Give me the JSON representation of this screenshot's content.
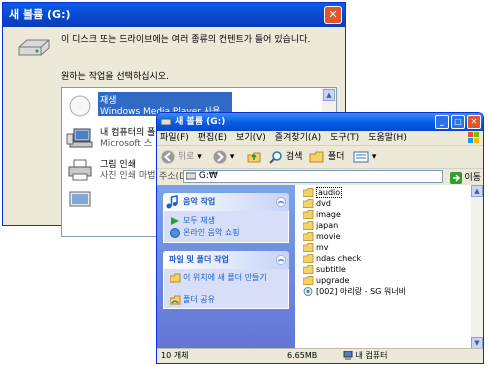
{
  "dialog": {
    "title": "새 볼륨 (G:)",
    "close_symbol": "✕",
    "message": "이 디스크 또는 드라이브에는 여러 종류의 컨텐트가 들어 있습니다.",
    "prompt": "원하는 작업을 선택하십시오.",
    "actions": [
      {
        "title": "재생",
        "subtitle": "Windows Media Player 사용",
        "icon": "media-player-icon"
      },
      {
        "title": "내 컴퓨터의 폴",
        "subtitle": "Microsoft 스",
        "icon": "copy-to-pc-icon"
      },
      {
        "title": "그림 인쇄",
        "subtitle": "사진 인쇄 마법",
        "icon": "printer-icon"
      },
      {
        "title": "",
        "subtitle": "",
        "icon": "slideshow-icon"
      }
    ]
  },
  "explorer": {
    "title": "새 볼륨 (G:)",
    "menu": [
      "파일(F)",
      "편집(E)",
      "보기(V)",
      "즐겨찾기(A)",
      "도구(T)",
      "도움말(H)"
    ],
    "toolbar": {
      "back": "뒤로",
      "search": "검색",
      "folders": "폴더"
    },
    "address": {
      "label": "주소(D)",
      "value": "G:₩",
      "go": "이동"
    },
    "music_tasks": {
      "header": "음악 작업",
      "items": [
        "모두 재생",
        "온라인 음악 쇼핑"
      ]
    },
    "file_tasks": {
      "header": "파일 및 폴더 작업",
      "items": [
        "이 위치에 새 폴더 만들기",
        "폴더 공유"
      ]
    },
    "files": [
      {
        "name": "audio",
        "type": "folder"
      },
      {
        "name": "dvd",
        "type": "folder"
      },
      {
        "name": "image",
        "type": "folder"
      },
      {
        "name": "japan",
        "type": "folder"
      },
      {
        "name": "movie",
        "type": "folder"
      },
      {
        "name": "mv",
        "type": "folder"
      },
      {
        "name": "ndas check",
        "type": "folder"
      },
      {
        "name": "subtitle",
        "type": "folder"
      },
      {
        "name": "upgrade",
        "type": "folder"
      },
      {
        "name": "[002] 아리랑 - SG 워너비",
        "type": "audio"
      }
    ],
    "status": {
      "count": "10 개체",
      "size": "6.65MB",
      "location": "내 컴퓨터"
    }
  },
  "colors": {
    "title_blue": "#0a5fe6",
    "task_blue": "#215dc6",
    "selection": "#316ac5",
    "close_red": "#e0562e"
  }
}
